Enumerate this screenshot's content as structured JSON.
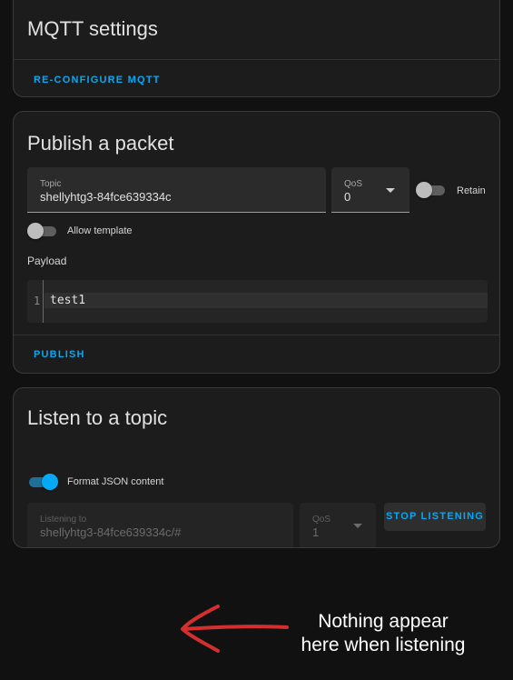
{
  "mqtt_settings": {
    "title": "MQTT settings",
    "reconfigure_label": "RE-CONFIGURE MQTT"
  },
  "publish": {
    "title": "Publish a packet",
    "topic_label": "Topic",
    "topic_value": "shellyhtg3-84fce639334c",
    "qos_label": "QoS",
    "qos_value": "0",
    "retain_label": "Retain",
    "retain_on": false,
    "allow_template_label": "Allow template",
    "allow_template_on": false,
    "payload_label": "Payload",
    "payload_line_number": "1",
    "payload_value": "test1",
    "publish_label": "PUBLISH"
  },
  "listen": {
    "title": "Listen to a topic",
    "format_json_label": "Format JSON content",
    "format_json_on": true,
    "listening_to_label": "Listening to",
    "listening_to_value": "shellyhtg3-84fce639334c/#",
    "qos_label": "QoS",
    "qos_value": "1",
    "stop_label": "STOP LISTENING"
  },
  "annotation": {
    "text_line1": "Nothing appear",
    "text_line2": "here when listening",
    "arrow_color": "#d32f2f"
  },
  "colors": {
    "accent": "#03a9f4",
    "background": "#111111",
    "card": "#1c1c1c"
  }
}
